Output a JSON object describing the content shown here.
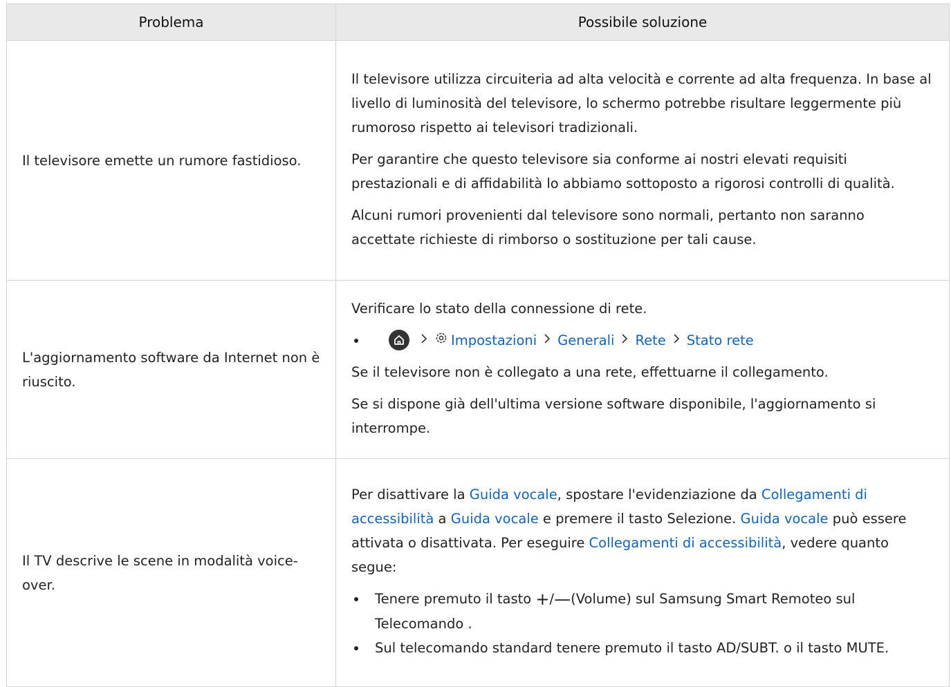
{
  "table": {
    "header_problem": "Problema",
    "header_solution": "Possibile soluzione"
  },
  "row1": {
    "problem": "Il televisore emette un rumore fastidioso.",
    "p1": "Il televisore utilizza circuiteria ad alta velocità e corrente ad alta frequenza. In base al livello di luminosità del televisore, lo schermo potrebbe risultare leggermente più rumoroso rispetto ai televisori tradizionali.",
    "p2": "Per garantire che questo televisore sia conforme ai nostri elevati requisiti prestazionali e di affidabilità lo abbiamo sottoposto a rigorosi controlli di qualità.",
    "p3": "Alcuni rumori provenienti dal televisore sono normali, pertanto non saranno accettate richieste di rimborso o sostituzione per tali cause."
  },
  "row2": {
    "problem": "L'aggiornamento software da Internet non è riuscito.",
    "p1": "Verificare lo stato della connessione di rete.",
    "path": {
      "settings": "Impostazioni",
      "general": "Generali",
      "network": "Rete",
      "status": "Stato rete"
    },
    "p2": "Se il televisore non è collegato a una rete, effettuarne il collegamento.",
    "p3": "Se si dispone già dell'ultima versione software disponibile, l'aggiornamento si interrompe."
  },
  "row3": {
    "problem": "Il TV descrive le scene in modalità voice-over.",
    "t1": "Per disattivare la ",
    "l1": "Guida vocale",
    "t2": ", spostare l'evidenziazione da ",
    "l2": "Collegamenti di accessibilità",
    "t3": " a ",
    "l3": "Guida vocale",
    "t4": " e premere il tasto Selezione. ",
    "l4": "Guida vocale",
    "t5": " può essere attivata o disattivata. Per eseguire ",
    "l5": "Collegamenti di accessibilità",
    "t6": ", vedere quanto segue:",
    "b1_pre": "Tenere premuto il tasto ",
    "b1_plus": "+",
    "b1_slash": "/",
    "b1_minus": "—",
    "b1_post": "(Volume) sul Samsung Smart Remoteo sul Telecomando .",
    "b2": "Sul telecomando standard tenere premuto il tasto AD/SUBT. o il tasto MUTE."
  },
  "icons": [
    "home-icon",
    "chevron-right-icon",
    "gear-icon"
  ],
  "colors": {
    "link": "#1563b5",
    "header_bg": "#e9e9e9",
    "border": "#d4d4d4"
  }
}
